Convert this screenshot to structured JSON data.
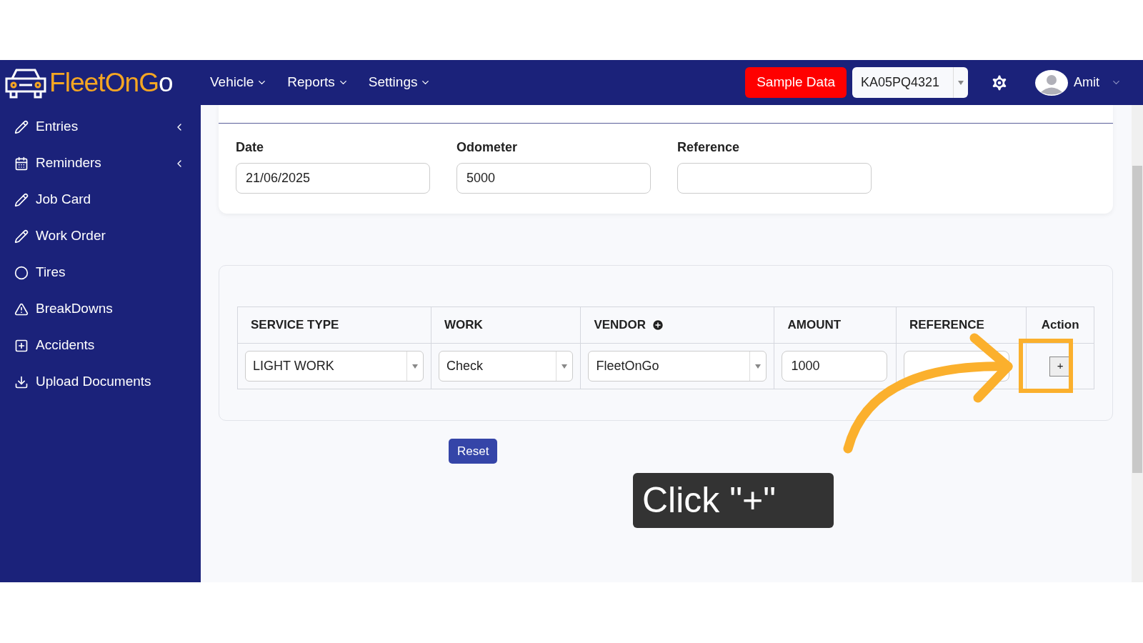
{
  "header": {
    "logo": {
      "part1": "Fleet",
      "part2": "On",
      "part3": "G",
      "part4": "o"
    },
    "menu": [
      {
        "label": "Vehicle"
      },
      {
        "label": "Reports"
      },
      {
        "label": "Settings"
      }
    ],
    "sample_button": "Sample Data",
    "vehicle_select": "KA05PQ4321",
    "user": "Amit"
  },
  "sidebar": {
    "items": [
      {
        "label": "Entries",
        "expandable": true
      },
      {
        "label": "Reminders",
        "expandable": true
      },
      {
        "label": "Job Card",
        "expandable": false
      },
      {
        "label": "Work Order",
        "expandable": false
      },
      {
        "label": "Tires",
        "expandable": false
      },
      {
        "label": "BreakDowns",
        "expandable": false
      },
      {
        "label": "Accidents",
        "expandable": false
      },
      {
        "label": "Upload Documents",
        "expandable": false
      }
    ]
  },
  "form": {
    "fields": [
      {
        "label": "Date",
        "value": "21/06/2025"
      },
      {
        "label": "Odometer",
        "value": "5000"
      },
      {
        "label": "Reference"
      }
    ]
  },
  "table": {
    "columns": [
      {
        "label": "SERVICE TYPE",
        "add_icon": false
      },
      {
        "label": "WORK",
        "add_icon": false
      },
      {
        "label": "VENDOR",
        "add_icon": true
      },
      {
        "label": "AMOUNT",
        "add_icon": false
      },
      {
        "label": "REFERENCE",
        "add_icon": false
      },
      {
        "label": "Action",
        "add_icon": false
      }
    ],
    "row": [
      {
        "kind": "select",
        "value": "LIGHT WORK"
      },
      {
        "kind": "select",
        "value": "Check"
      },
      {
        "kind": "select",
        "value": "FleetOnGo"
      },
      {
        "kind": "input",
        "value": "1000"
      },
      {
        "kind": "input"
      },
      {
        "kind": "button",
        "value": "+"
      }
    ]
  },
  "reset_button": "Reset",
  "callout": "Click \"+\""
}
